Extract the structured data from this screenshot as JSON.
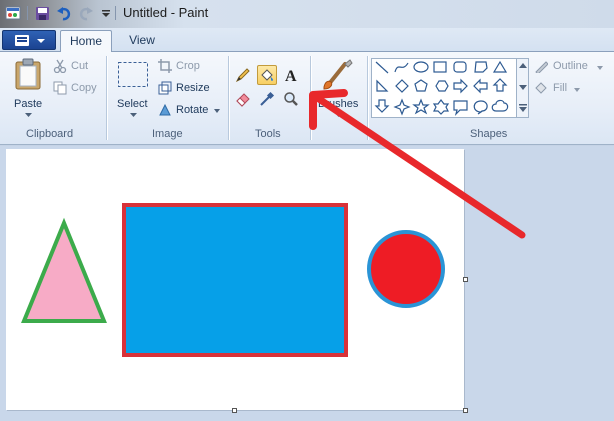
{
  "window": {
    "title": "Untitled - Paint"
  },
  "tabs": [
    {
      "label": "Home"
    },
    {
      "label": "View"
    }
  ],
  "clipboard": {
    "paste_label": "Paste",
    "cut_label": "Cut",
    "copy_label": "Copy",
    "group_label": "Clipboard"
  },
  "image": {
    "select_label": "Select",
    "crop_label": "Crop",
    "resize_label": "Resize",
    "rotate_label": "Rotate",
    "group_label": "Image"
  },
  "tools": {
    "group_label": "Tools",
    "items": [
      "pencil-icon",
      "fill-bucket-icon",
      "text-icon",
      "eraser-icon",
      "color-picker-icon",
      "magnifier-icon"
    ],
    "selected": "fill-bucket-icon"
  },
  "brushes": {
    "label": "Brushes"
  },
  "shapes": {
    "group_label": "Shapes",
    "outline_label": "Outline",
    "fill_label": "Fill"
  },
  "canvas_shapes": [
    {
      "kind": "triangle",
      "fill": "#f7abc6",
      "stroke": "#3cab4b"
    },
    {
      "kind": "rectangle",
      "fill": "#06a0e8",
      "stroke": "#d83239"
    },
    {
      "kind": "circle",
      "fill": "#ee1c25",
      "stroke": "#2a94d6"
    }
  ],
  "annotation_arrow_color": "#e8282b"
}
